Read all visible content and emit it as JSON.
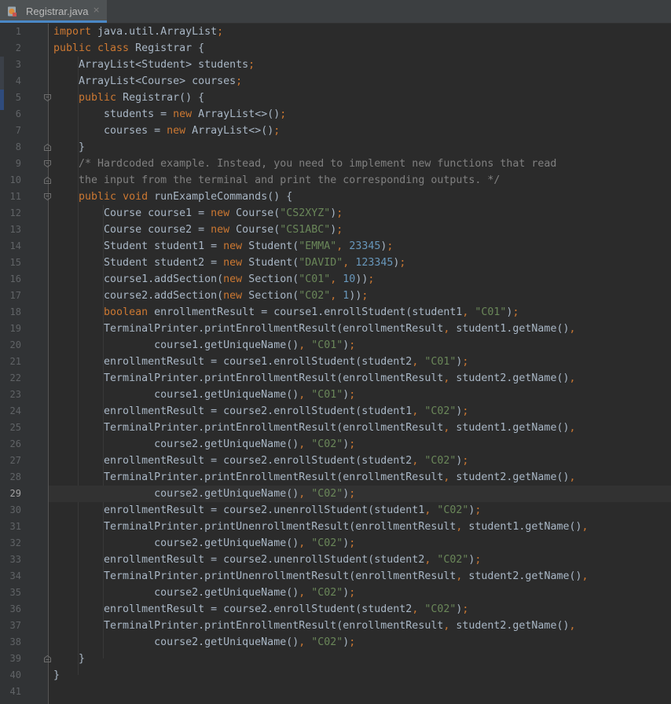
{
  "tab": {
    "label": "Registrar.java",
    "close": "×",
    "icon": "java-file-icon"
  },
  "colors": {
    "background": "#2b2b2b",
    "keyword": "#cc7832",
    "string": "#6a8759",
    "number": "#6897bb",
    "comment": "#808080",
    "plain": "#a9b7c6",
    "tab_underline": "#4a88c7"
  },
  "editor": {
    "current_line": 29,
    "lines": [
      {
        "n": "1",
        "code": [
          {
            "t": "import",
            "c": "kw"
          },
          {
            "t": " java.util.ArrayList"
          },
          {
            "t": ";",
            "c": "kw"
          }
        ]
      },
      {
        "n": "2",
        "code": [
          {
            "t": "public class",
            "c": "kw"
          },
          {
            "t": " Registrar {"
          }
        ]
      },
      {
        "n": "3",
        "code": [
          {
            "t": "    ArrayList<Student> students"
          },
          {
            "t": ";",
            "c": "kw"
          }
        ]
      },
      {
        "n": "4",
        "code": [
          {
            "t": "    ArrayList<Course> courses"
          },
          {
            "t": ";",
            "c": "kw"
          }
        ]
      },
      {
        "n": "5",
        "code": [
          {
            "t": "    "
          },
          {
            "t": "public",
            "c": "kw"
          },
          {
            "t": " Registrar() {"
          }
        ]
      },
      {
        "n": "6",
        "code": [
          {
            "t": "        students = "
          },
          {
            "t": "new",
            "c": "kw"
          },
          {
            "t": " ArrayList<>()"
          },
          {
            "t": ";",
            "c": "kw"
          }
        ]
      },
      {
        "n": "7",
        "code": [
          {
            "t": "        courses = "
          },
          {
            "t": "new",
            "c": "kw"
          },
          {
            "t": " ArrayList<>()"
          },
          {
            "t": ";",
            "c": "kw"
          }
        ]
      },
      {
        "n": "8",
        "code": [
          {
            "t": "    }"
          }
        ]
      },
      {
        "n": "9",
        "code": [
          {
            "t": "    /* Hardcoded example. Instead, you need to implement new functions that read",
            "c": "cmt"
          }
        ]
      },
      {
        "n": "10",
        "code": [
          {
            "t": "    the input from the terminal and print the corresponding outputs. */",
            "c": "cmt"
          }
        ]
      },
      {
        "n": "11",
        "code": [
          {
            "t": "    "
          },
          {
            "t": "public void",
            "c": "kw"
          },
          {
            "t": " runExampleCommands() {"
          }
        ]
      },
      {
        "n": "12",
        "code": [
          {
            "t": "        Course course1 = "
          },
          {
            "t": "new",
            "c": "kw"
          },
          {
            "t": " Course("
          },
          {
            "t": "\"CS2XYZ\"",
            "c": "str"
          },
          {
            "t": ")"
          },
          {
            "t": ";",
            "c": "kw"
          }
        ]
      },
      {
        "n": "13",
        "code": [
          {
            "t": "        Course course2 = "
          },
          {
            "t": "new",
            "c": "kw"
          },
          {
            "t": " Course("
          },
          {
            "t": "\"CS1ABC\"",
            "c": "str"
          },
          {
            "t": ")"
          },
          {
            "t": ";",
            "c": "kw"
          }
        ]
      },
      {
        "n": "14",
        "code": [
          {
            "t": "        Student student1 = "
          },
          {
            "t": "new",
            "c": "kw"
          },
          {
            "t": " Student("
          },
          {
            "t": "\"EMMA\"",
            "c": "str"
          },
          {
            "t": ", ",
            "c": "kw"
          },
          {
            "t": "23345",
            "c": "num"
          },
          {
            "t": ")"
          },
          {
            "t": ";",
            "c": "kw"
          }
        ]
      },
      {
        "n": "15",
        "code": [
          {
            "t": "        Student student2 = "
          },
          {
            "t": "new",
            "c": "kw"
          },
          {
            "t": " Student("
          },
          {
            "t": "\"DAVID\"",
            "c": "str"
          },
          {
            "t": ", ",
            "c": "kw"
          },
          {
            "t": "123345",
            "c": "num"
          },
          {
            "t": ")"
          },
          {
            "t": ";",
            "c": "kw"
          }
        ]
      },
      {
        "n": "16",
        "code": [
          {
            "t": "        course1.addSection("
          },
          {
            "t": "new",
            "c": "kw"
          },
          {
            "t": " Section("
          },
          {
            "t": "\"C01\"",
            "c": "str"
          },
          {
            "t": ", ",
            "c": "kw"
          },
          {
            "t": "10",
            "c": "num"
          },
          {
            "t": "))"
          },
          {
            "t": ";",
            "c": "kw"
          }
        ]
      },
      {
        "n": "17",
        "code": [
          {
            "t": "        course2.addSection("
          },
          {
            "t": "new",
            "c": "kw"
          },
          {
            "t": " Section("
          },
          {
            "t": "\"C02\"",
            "c": "str"
          },
          {
            "t": ", ",
            "c": "kw"
          },
          {
            "t": "1",
            "c": "num"
          },
          {
            "t": "))"
          },
          {
            "t": ";",
            "c": "kw"
          }
        ]
      },
      {
        "n": "18",
        "code": [
          {
            "t": "        "
          },
          {
            "t": "boolean",
            "c": "kw"
          },
          {
            "t": " enrollmentResult = course1.enrollStudent(student1"
          },
          {
            "t": ", ",
            "c": "kw"
          },
          {
            "t": "\"C01\"",
            "c": "str"
          },
          {
            "t": ")"
          },
          {
            "t": ";",
            "c": "kw"
          }
        ]
      },
      {
        "n": "19",
        "code": [
          {
            "t": "        TerminalPrinter.printEnrollmentResult(enrollmentResult"
          },
          {
            "t": ", ",
            "c": "kw"
          },
          {
            "t": "student1.getName()"
          },
          {
            "t": ",",
            "c": "kw"
          }
        ]
      },
      {
        "n": "20",
        "code": [
          {
            "t": "                course1.getUniqueName()"
          },
          {
            "t": ", ",
            "c": "kw"
          },
          {
            "t": "\"C01\"",
            "c": "str"
          },
          {
            "t": ")"
          },
          {
            "t": ";",
            "c": "kw"
          }
        ]
      },
      {
        "n": "21",
        "code": [
          {
            "t": "        enrollmentResult = course1.enrollStudent(student2"
          },
          {
            "t": ", ",
            "c": "kw"
          },
          {
            "t": "\"C01\"",
            "c": "str"
          },
          {
            "t": ")"
          },
          {
            "t": ";",
            "c": "kw"
          }
        ]
      },
      {
        "n": "22",
        "code": [
          {
            "t": "        TerminalPrinter.printEnrollmentResult(enrollmentResult"
          },
          {
            "t": ", ",
            "c": "kw"
          },
          {
            "t": "student2.getName()"
          },
          {
            "t": ",",
            "c": "kw"
          }
        ]
      },
      {
        "n": "23",
        "code": [
          {
            "t": "                course1.getUniqueName()"
          },
          {
            "t": ", ",
            "c": "kw"
          },
          {
            "t": "\"C01\"",
            "c": "str"
          },
          {
            "t": ")"
          },
          {
            "t": ";",
            "c": "kw"
          }
        ]
      },
      {
        "n": "24",
        "code": [
          {
            "t": "        enrollmentResult = course2.enrollStudent(student1"
          },
          {
            "t": ", ",
            "c": "kw"
          },
          {
            "t": "\"C02\"",
            "c": "str"
          },
          {
            "t": ")"
          },
          {
            "t": ";",
            "c": "kw"
          }
        ]
      },
      {
        "n": "25",
        "code": [
          {
            "t": "        TerminalPrinter.printEnrollmentResult(enrollmentResult"
          },
          {
            "t": ", ",
            "c": "kw"
          },
          {
            "t": "student1.getName()"
          },
          {
            "t": ",",
            "c": "kw"
          }
        ]
      },
      {
        "n": "26",
        "code": [
          {
            "t": "                course2.getUniqueName()"
          },
          {
            "t": ", ",
            "c": "kw"
          },
          {
            "t": "\"C02\"",
            "c": "str"
          },
          {
            "t": ")"
          },
          {
            "t": ";",
            "c": "kw"
          }
        ]
      },
      {
        "n": "27",
        "code": [
          {
            "t": "        enrollmentResult = course2.enrollStudent(student2"
          },
          {
            "t": ", ",
            "c": "kw"
          },
          {
            "t": "\"C02\"",
            "c": "str"
          },
          {
            "t": ")"
          },
          {
            "t": ";",
            "c": "kw"
          }
        ]
      },
      {
        "n": "28",
        "code": [
          {
            "t": "        TerminalPrinter.printEnrollmentResult(enrollmentResult"
          },
          {
            "t": ", ",
            "c": "kw"
          },
          {
            "t": "student2.getName()"
          },
          {
            "t": ",",
            "c": "kw"
          }
        ]
      },
      {
        "n": "29",
        "code": [
          {
            "t": "                course2.getUniqueName()"
          },
          {
            "t": ", ",
            "c": "kw"
          },
          {
            "t": "\"C02\"",
            "c": "str"
          },
          {
            "t": ")"
          },
          {
            "t": ";",
            "c": "kw"
          }
        ]
      },
      {
        "n": "30",
        "code": [
          {
            "t": "        enrollmentResult = course2.unenrollStudent(student1"
          },
          {
            "t": ", ",
            "c": "kw"
          },
          {
            "t": "\"C02\"",
            "c": "str"
          },
          {
            "t": ")"
          },
          {
            "t": ";",
            "c": "kw"
          }
        ]
      },
      {
        "n": "31",
        "code": [
          {
            "t": "        TerminalPrinter.printUnenrollmentResult(enrollmentResult"
          },
          {
            "t": ", ",
            "c": "kw"
          },
          {
            "t": "student1.getName()"
          },
          {
            "t": ",",
            "c": "kw"
          }
        ]
      },
      {
        "n": "32",
        "code": [
          {
            "t": "                course2.getUniqueName()"
          },
          {
            "t": ", ",
            "c": "kw"
          },
          {
            "t": "\"C02\"",
            "c": "str"
          },
          {
            "t": ")"
          },
          {
            "t": ";",
            "c": "kw"
          }
        ]
      },
      {
        "n": "33",
        "code": [
          {
            "t": "        enrollmentResult = course2.unenrollStudent(student2"
          },
          {
            "t": ", ",
            "c": "kw"
          },
          {
            "t": "\"C02\"",
            "c": "str"
          },
          {
            "t": ")"
          },
          {
            "t": ";",
            "c": "kw"
          }
        ]
      },
      {
        "n": "34",
        "code": [
          {
            "t": "        TerminalPrinter.printUnenrollmentResult(enrollmentResult"
          },
          {
            "t": ", ",
            "c": "kw"
          },
          {
            "t": "student2.getName()"
          },
          {
            "t": ",",
            "c": "kw"
          }
        ]
      },
      {
        "n": "35",
        "code": [
          {
            "t": "                course2.getUniqueName()"
          },
          {
            "t": ", ",
            "c": "kw"
          },
          {
            "t": "\"C02\"",
            "c": "str"
          },
          {
            "t": ")"
          },
          {
            "t": ";",
            "c": "kw"
          }
        ]
      },
      {
        "n": "36",
        "code": [
          {
            "t": "        enrollmentResult = course2.enrollStudent(student2"
          },
          {
            "t": ", ",
            "c": "kw"
          },
          {
            "t": "\"C02\"",
            "c": "str"
          },
          {
            "t": ")"
          },
          {
            "t": ";",
            "c": "kw"
          }
        ]
      },
      {
        "n": "37",
        "code": [
          {
            "t": "        TerminalPrinter.printEnrollmentResult(enrollmentResult"
          },
          {
            "t": ", ",
            "c": "kw"
          },
          {
            "t": "student2.getName()"
          },
          {
            "t": ",",
            "c": "kw"
          }
        ]
      },
      {
        "n": "38",
        "code": [
          {
            "t": "                course2.getUniqueName()"
          },
          {
            "t": ", ",
            "c": "kw"
          },
          {
            "t": "\"C02\"",
            "c": "str"
          },
          {
            "t": ")"
          },
          {
            "t": ";",
            "c": "kw"
          }
        ]
      },
      {
        "n": "39",
        "code": [
          {
            "t": "    }"
          }
        ]
      },
      {
        "n": "40",
        "code": [
          {
            "t": "}"
          }
        ]
      },
      {
        "n": "41",
        "code": [
          {
            "t": ""
          }
        ]
      }
    ]
  }
}
